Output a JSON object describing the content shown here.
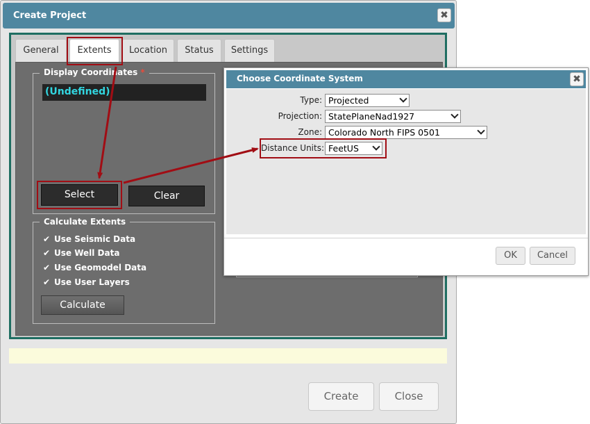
{
  "main_dialog": {
    "title": "Create Project",
    "close_glyph": "✖",
    "tabs": [
      {
        "label": "General"
      },
      {
        "label": "Extents"
      },
      {
        "label": "Location"
      },
      {
        "label": "Status"
      },
      {
        "label": "Settings"
      }
    ],
    "active_tab": "Extents",
    "display_coordinates": {
      "legend": "Display Coordinates",
      "required_marker": "*",
      "value": "(Undefined)",
      "select_label": "Select",
      "clear_label": "Clear"
    },
    "calculate_extents": {
      "legend": "Calculate Extents",
      "options": [
        {
          "label": "Use Seismic Data",
          "checked": true
        },
        {
          "label": "Use Well Data",
          "checked": true
        },
        {
          "label": "Use Geomodel Data",
          "checked": true
        },
        {
          "label": "Use User Layers",
          "checked": true
        }
      ],
      "check_glyph": "✔",
      "calculate_label": "Calculate"
    },
    "footer": {
      "create_label": "Create",
      "close_label": "Close"
    }
  },
  "coordinate_dialog": {
    "title": "Choose Coordinate System",
    "close_glyph": "✖",
    "fields": {
      "type": {
        "label": "Type:",
        "value": "Projected"
      },
      "projection": {
        "label": "Projection:",
        "value": "StatePlaneNad1927"
      },
      "zone": {
        "label": "Zone:",
        "value": "Colorado North FIPS 0501"
      },
      "distance_units": {
        "label": "Distance Units:",
        "value": "FeetUS"
      }
    },
    "ok_label": "OK",
    "cancel_label": "Cancel"
  },
  "colors": {
    "titlebar": "#4f87a0",
    "frame_border": "#1f6e62",
    "highlight": "#a10d14",
    "undefined_text": "#32d6e0"
  }
}
